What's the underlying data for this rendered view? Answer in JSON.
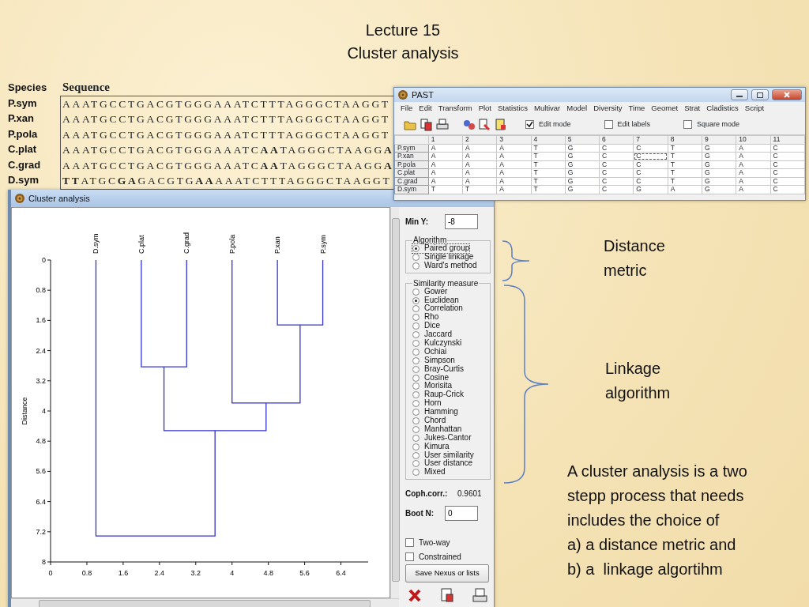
{
  "slide_title": [
    "Lecture 15",
    "Cluster analysis"
  ],
  "sequence_table": {
    "columns": [
      "Species",
      "Sequence"
    ],
    "rows": [
      {
        "species": "P.sym",
        "sequence": "AAATGCCTGACGTGGGAAATCTTTAGGGCTAAGGT"
      },
      {
        "species": "P.xan",
        "sequence": "AAATGCCTGACGTGGGAAATCTTTAGGGCTAAGGT"
      },
      {
        "species": "P.pola",
        "sequence": "AAATGCCTGACGTGGGAAATCTTTAGGGCTAAGGT"
      },
      {
        "species": "C.plat",
        "sequence": "AAATGCCTGACGTGGGAAATC**AA**TAGGGCTAAGG**A**"
      },
      {
        "species": "C.grad",
        "sequence": "AAATGCCTGACGTGGGAAATC**AA**TAGGGCTAAGG**A**"
      },
      {
        "species": "D.sym",
        "sequence": "**TT**ATGC**GA**GACGTG**AA**AAATCTTTAGGGCTAAGGT"
      }
    ]
  },
  "past_window": {
    "title": "PAST",
    "menu": [
      "File",
      "Edit",
      "Transform",
      "Plot",
      "Statistics",
      "Multivar",
      "Model",
      "Diversity",
      "Time",
      "Geomet",
      "Strat",
      "Cladistics",
      "Script"
    ],
    "checkboxes": [
      {
        "label": "Edit mode",
        "checked": true
      },
      {
        "label": "Edit labels",
        "checked": false
      },
      {
        "label": "Square mode",
        "checked": false
      }
    ],
    "grid": {
      "columns": [
        "1",
        "2",
        "3",
        "4",
        "5",
        "6",
        "7",
        "8",
        "9",
        "10",
        "11"
      ],
      "rows": [
        {
          "label": "P.sym",
          "cells": [
            "A",
            "A",
            "A",
            "T",
            "G",
            "C",
            "C",
            "T",
            "G",
            "A",
            "C"
          ]
        },
        {
          "label": "P.xan",
          "cells": [
            "A",
            "A",
            "A",
            "T",
            "G",
            "C",
            "C",
            "T",
            "G",
            "A",
            "C"
          ]
        },
        {
          "label": "P.pola",
          "cells": [
            "A",
            "A",
            "A",
            "T",
            "G",
            "C",
            "C",
            "T",
            "G",
            "A",
            "C"
          ]
        },
        {
          "label": "C.plat",
          "cells": [
            "A",
            "A",
            "A",
            "T",
            "G",
            "C",
            "C",
            "T",
            "G",
            "A",
            "C"
          ]
        },
        {
          "label": "C.grad",
          "cells": [
            "A",
            "A",
            "A",
            "T",
            "G",
            "C",
            "C",
            "T",
            "G",
            "A",
            "C"
          ]
        },
        {
          "label": "D.sym",
          "cells": [
            "T",
            "T",
            "A",
            "T",
            "G",
            "C",
            "G",
            "A",
            "G",
            "A",
            "C"
          ]
        }
      ]
    }
  },
  "cluster_window": {
    "title": "Cluster analysis",
    "chart_data": {
      "type": "line",
      "ylabel": "Distance",
      "xlim": [
        0,
        7
      ],
      "ylim": [
        8,
        0
      ],
      "annotations": [
        {
          "x": 1,
          "y": 0,
          "text": "D.sym"
        },
        {
          "x": 2,
          "y": 0,
          "text": "C.plat"
        },
        {
          "x": 3,
          "y": 0,
          "text": "C.grad"
        },
        {
          "x": 4,
          "y": 0,
          "text": "P.pola"
        },
        {
          "x": 5,
          "y": 0,
          "text": "P.xan"
        },
        {
          "x": 6,
          "y": 0,
          "text": "P.sym"
        }
      ],
      "xticks": [
        0,
        0.8,
        1.6,
        2.4,
        3.2,
        4,
        4.8,
        5.6,
        6.4
      ],
      "yticks": [
        0,
        0.8,
        1.6,
        2.4,
        3.2,
        4,
        4.8,
        5.6,
        6.4,
        7.2,
        8
      ],
      "series": [
        {
          "color": "#3333cc",
          "x": [
            5,
            5,
            6,
            6
          ],
          "values": [
            0,
            1.72,
            1.72,
            0
          ]
        },
        {
          "color": "#3333cc",
          "x": [
            2,
            2,
            3,
            3
          ],
          "values": [
            0,
            2.83,
            2.83,
            0
          ]
        },
        {
          "color": "#3333cc",
          "x": [
            4,
            4,
            5.5,
            5.5
          ],
          "values": [
            0,
            3.79,
            3.79,
            1.72
          ]
        },
        {
          "color": "#3333cc",
          "x": [
            2.5,
            2.5,
            4.75,
            4.75
          ],
          "values": [
            2.83,
            4.52,
            4.52,
            3.79
          ]
        },
        {
          "color": "#3333cc",
          "x": [
            1,
            1,
            3.625,
            3.625
          ],
          "values": [
            0,
            7.31,
            7.31,
            4.52
          ]
        }
      ]
    },
    "min_y": {
      "label": "Min Y:",
      "value": "-8"
    },
    "algorithm": {
      "legend": "Algorithm",
      "options": [
        {
          "label": "Paired group",
          "selected": true
        },
        {
          "label": "Single linkage",
          "selected": false
        },
        {
          "label": "Ward's method",
          "selected": false
        }
      ]
    },
    "similarity": {
      "legend": "Similarity measure",
      "options": [
        {
          "label": "Gower",
          "selected": false
        },
        {
          "label": "Euclidean",
          "selected": true
        },
        {
          "label": "Correlation",
          "selected": false
        },
        {
          "label": "Rho",
          "selected": false
        },
        {
          "label": "Dice",
          "selected": false
        },
        {
          "label": "Jaccard",
          "selected": false
        },
        {
          "label": "Kulczynski",
          "selected": false
        },
        {
          "label": "Ochiai",
          "selected": false
        },
        {
          "label": "Simpson",
          "selected": false
        },
        {
          "label": "Bray-Curtis",
          "selected": false
        },
        {
          "label": "Cosine",
          "selected": false
        },
        {
          "label": "Morisita",
          "selected": false
        },
        {
          "label": "Raup-Crick",
          "selected": false
        },
        {
          "label": "Horn",
          "selected": false
        },
        {
          "label": "Hamming",
          "selected": false
        },
        {
          "label": "Chord",
          "selected": false
        },
        {
          "label": "Manhattan",
          "selected": false
        },
        {
          "label": "Jukes-Cantor",
          "selected": false
        },
        {
          "label": "Kimura",
          "selected": false
        },
        {
          "label": "User similarity",
          "selected": false
        },
        {
          "label": "User distance",
          "selected": false
        },
        {
          "label": "Mixed",
          "selected": false
        }
      ]
    },
    "coph_corr": {
      "label": "Coph.corr.:",
      "value": "0.9601"
    },
    "boot_n": {
      "label": "Boot N:",
      "value": "0"
    },
    "checkboxes": [
      {
        "label": "Two-way",
        "checked": false
      },
      {
        "label": "Constrained",
        "checked": false
      }
    ],
    "save_button": "Save Nexus or lists"
  },
  "annotations": [
    {
      "lines": [
        "Distance",
        "metric"
      ]
    },
    {
      "lines": [
        "Linkage",
        "algorithm"
      ]
    }
  ],
  "note": {
    "lines": [
      "A cluster analysis is a two",
      "stepp process that needs",
      "includes the choice of",
      "a) a distance metric and",
      "b) a  linkage algortihm"
    ]
  }
}
